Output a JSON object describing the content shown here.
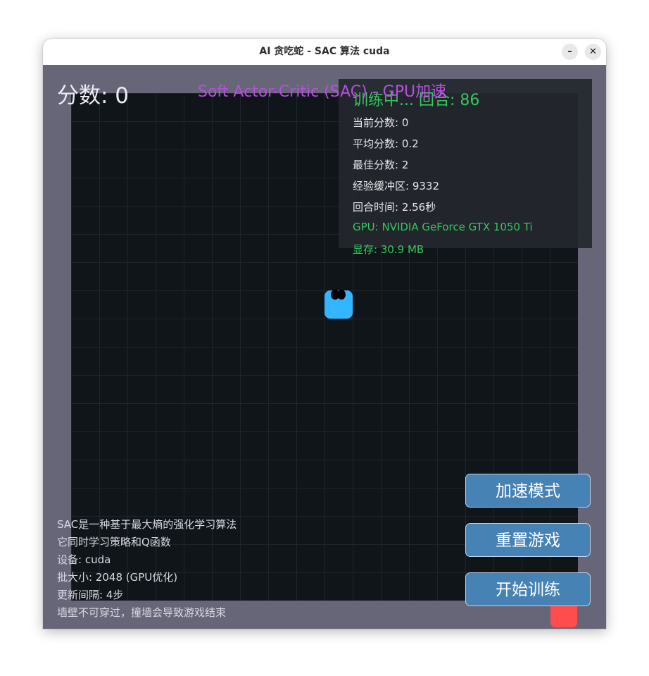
{
  "window": {
    "title": "AI 贪吃蛇 - SAC 算法  cuda",
    "minimize_glyph": "–",
    "close_glyph": "✕"
  },
  "game": {
    "score_text": "分数: 0",
    "subtitle": "Soft Actor-Critic (SAC) - GPU加速",
    "snake_color": "#33b5ff",
    "food_color": "#ff4d4d",
    "board_color": "#10151a",
    "border_color": "#666678"
  },
  "stats": {
    "training_status": "训练中... 回合: 86",
    "current_score": "当前分数: 0",
    "average_score": "平均分数: 0.2",
    "best_score": "最佳分数: 2",
    "replay_buffer": "经验缓冲区: 9332",
    "episode_time": "回合时间: 2.56秒",
    "gpu": "GPU: NVIDIA GeForce GTX 1050 Ti",
    "vram": "显存: 30.9 MB"
  },
  "info": {
    "line1": "SAC是一种基于最大熵的强化学习算法",
    "line2": "它同时学习策略和Q函数",
    "line3": "设备: cuda",
    "line4": "批大小: 2048 (GPU优化)",
    "line5": "更新间隔: 4步",
    "line6": "墙壁不可穿过，撞墙会导致游戏结束"
  },
  "buttons": {
    "speed_mode": "加速模式",
    "reset_game": "重置游戏",
    "start_training": "开始训练"
  },
  "colors": {
    "accent_green": "#32c85a",
    "accent_purple": "#b84ee0",
    "button_blue": "#4682b4"
  }
}
